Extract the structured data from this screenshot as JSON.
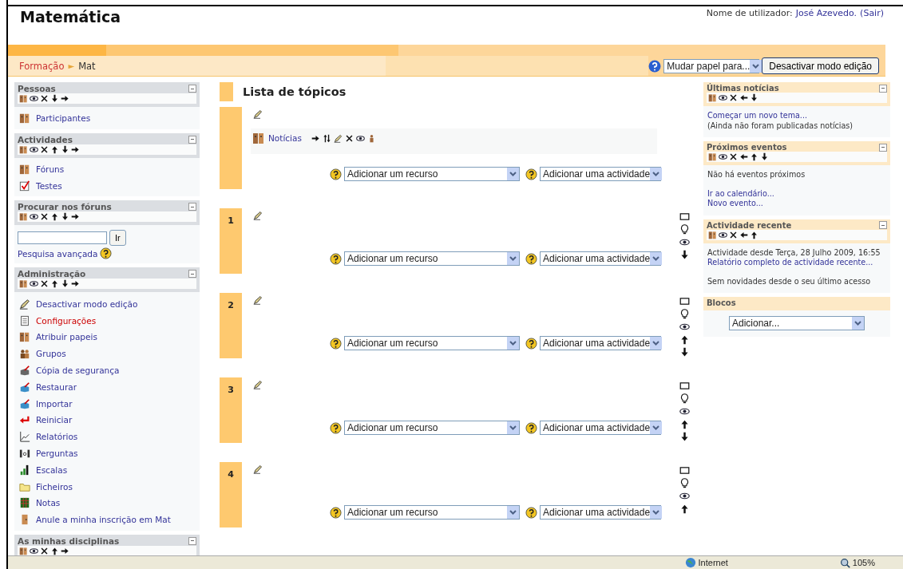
{
  "header": {
    "title": "Matemática",
    "user_label": "Nome de utilizador:",
    "user_name": "José Azevedo.",
    "logout": "(Sair)"
  },
  "breadcrumb": {
    "items": [
      "Formação",
      "Mat"
    ],
    "separator": "►"
  },
  "toolbar": {
    "role_select": "Mudar papel para...",
    "edit_button": "Desactivar modo edição"
  },
  "left_blocks": [
    {
      "title": "Pessoas",
      "controls": [
        {
          "kind": "roles"
        },
        {
          "kind": "hide"
        },
        {
          "kind": "delete"
        },
        {
          "kind": "down"
        },
        {
          "kind": "right"
        }
      ],
      "items": [
        {
          "kind": "users",
          "label": "Participantes",
          "color": "#333399"
        }
      ]
    },
    {
      "title": "Actividades",
      "controls": [
        {
          "kind": "roles"
        },
        {
          "kind": "hide"
        },
        {
          "kind": "delete"
        },
        {
          "kind": "up"
        },
        {
          "kind": "down"
        },
        {
          "kind": "right"
        }
      ],
      "items": [
        {
          "kind": "forum",
          "label": "Fóruns",
          "color": "#333399"
        },
        {
          "kind": "quiz",
          "label": "Testes",
          "color": "#333399"
        }
      ]
    },
    {
      "title": "Procurar nos fóruns",
      "controls": [
        {
          "kind": "roles"
        },
        {
          "kind": "hide"
        },
        {
          "kind": "delete"
        },
        {
          "kind": "up"
        },
        {
          "kind": "down"
        },
        {
          "kind": "right"
        }
      ],
      "search": {
        "button": "Ir",
        "advanced": "Pesquisa avançada"
      }
    },
    {
      "title": "Administração",
      "controls": [
        {
          "kind": "roles"
        },
        {
          "kind": "hide"
        },
        {
          "kind": "delete"
        },
        {
          "kind": "up"
        },
        {
          "kind": "down"
        },
        {
          "kind": "right"
        }
      ],
      "items": [
        {
          "kind": "edit",
          "label": "Desactivar modo edição",
          "color": "#333399"
        },
        {
          "kind": "settings",
          "label": "Configurações",
          "color": "#cc0000"
        },
        {
          "kind": "roles",
          "label": "Atribuir papeis",
          "color": "#333399"
        },
        {
          "kind": "groups",
          "label": "Grupos",
          "color": "#333399"
        },
        {
          "kind": "backup",
          "label": "Cópia de segurança",
          "color": "#333399"
        },
        {
          "kind": "restore",
          "label": "Restaurar",
          "color": "#333399"
        },
        {
          "kind": "restore",
          "label": "Importar",
          "color": "#333399"
        },
        {
          "kind": "reset",
          "label": "Reiniciar",
          "color": "#333399"
        },
        {
          "kind": "reports",
          "label": "Relatórios",
          "color": "#333399"
        },
        {
          "kind": "questions",
          "label": "Perguntas",
          "color": "#333399"
        },
        {
          "kind": "scales",
          "label": "Escalas",
          "color": "#333399"
        },
        {
          "kind": "files",
          "label": "Ficheiros",
          "color": "#333399"
        },
        {
          "kind": "grades",
          "label": "Notas",
          "color": "#333399"
        },
        {
          "kind": "unenrol",
          "label": "Anule a minha inscrição em Mat",
          "color": "#333399"
        }
      ]
    },
    {
      "title": "As minhas disciplinas",
      "controls": [
        {
          "kind": "roles"
        },
        {
          "kind": "hide"
        },
        {
          "kind": "delete"
        },
        {
          "kind": "up"
        },
        {
          "kind": "right"
        }
      ]
    }
  ],
  "topics": {
    "title": "Lista de tópicos",
    "sections": [
      {
        "activities": [
          {
            "label": "Notícias",
            "controls": [
              {
                "kind": "right"
              },
              {
                "kind": "move"
              },
              {
                "kind": "edit"
              },
              {
                "kind": "delete"
              },
              {
                "kind": "hide"
              },
              {
                "kind": "role"
              }
            ]
          }
        ],
        "resource_select": "Adicionar um recurso",
        "activity_select": "Adicionar uma actividade"
      },
      {
        "number": "1",
        "resource_select": "Adicionar um recurso",
        "activity_select": "Adicionar uma actividade",
        "controls": [
          {
            "kind": "highlight"
          },
          {
            "kind": "bulb"
          },
          {
            "kind": "hide"
          },
          {
            "kind": "down"
          }
        ]
      },
      {
        "number": "2",
        "resource_select": "Adicionar um recurso",
        "activity_select": "Adicionar uma actividade",
        "controls": [
          {
            "kind": "highlight"
          },
          {
            "kind": "bulb"
          },
          {
            "kind": "hide"
          },
          {
            "kind": "up"
          },
          {
            "kind": "down"
          }
        ]
      },
      {
        "number": "3",
        "resource_select": "Adicionar um recurso",
        "activity_select": "Adicionar uma actividade",
        "controls": [
          {
            "kind": "highlight"
          },
          {
            "kind": "bulb"
          },
          {
            "kind": "hide"
          },
          {
            "kind": "up"
          },
          {
            "kind": "down"
          }
        ]
      },
      {
        "number": "4",
        "resource_select": "Adicionar um recurso",
        "activity_select": "Adicionar uma actividade",
        "controls": [
          {
            "kind": "highlight"
          },
          {
            "kind": "bulb"
          },
          {
            "kind": "hide"
          },
          {
            "kind": "up"
          }
        ]
      }
    ]
  },
  "right_blocks": [
    {
      "title": "Últimas notícias",
      "controls": [
        {
          "kind": "roles"
        },
        {
          "kind": "hide"
        },
        {
          "kind": "delete"
        },
        {
          "kind": "left"
        },
        {
          "kind": "down"
        }
      ],
      "groups": [
        [
          {
            "kind": "link",
            "text": "Começar um novo tema..."
          },
          {
            "kind": "text",
            "text": "(Ainda não foram publicadas notícias)"
          }
        ]
      ]
    },
    {
      "title": "Próximos eventos",
      "controls": [
        {
          "kind": "roles"
        },
        {
          "kind": "hide"
        },
        {
          "kind": "delete"
        },
        {
          "kind": "left"
        },
        {
          "kind": "up"
        },
        {
          "kind": "down"
        }
      ],
      "groups": [
        [
          {
            "kind": "text",
            "text": "Não há eventos próximos"
          }
        ],
        [
          {
            "kind": "link",
            "text": "Ir ao calendário..."
          },
          {
            "kind": "link",
            "text": "Novo evento..."
          }
        ]
      ]
    },
    {
      "title": "Actividade recente",
      "controls": [
        {
          "kind": "roles"
        },
        {
          "kind": "hide"
        },
        {
          "kind": "delete"
        },
        {
          "kind": "left"
        },
        {
          "kind": "up"
        }
      ],
      "groups": [
        [
          {
            "kind": "text",
            "text": "Actividade desde Terça, 28 Julho 2009, 16:55"
          },
          {
            "kind": "link",
            "text": "Relatório completo de actividade recente..."
          }
        ],
        [
          {
            "kind": "text",
            "text": "Sem novidades desde o seu último acesso"
          }
        ]
      ]
    },
    {
      "title": "Blocos",
      "select": "Adicionar..."
    }
  ],
  "status_bar": {
    "zone": "Internet",
    "zoom": "105%"
  }
}
